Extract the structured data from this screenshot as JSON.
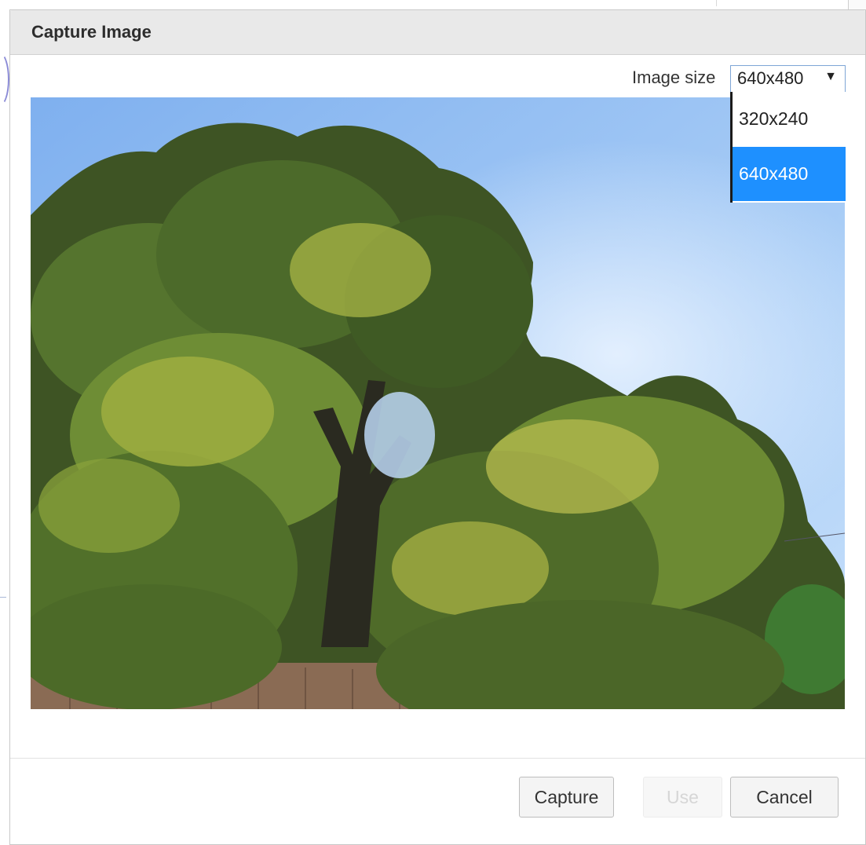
{
  "dialog": {
    "title": "Capture Image"
  },
  "image_size": {
    "label": "Image size",
    "selected": "640x480",
    "arrow_icon": "triangle-down-icon",
    "options": [
      {
        "label": "320x240",
        "highlighted": false
      },
      {
        "label": "640x480",
        "highlighted": true
      }
    ]
  },
  "preview": {
    "icon": "camera-preview-image"
  },
  "buttons": {
    "capture": "Capture",
    "use": "Use",
    "cancel": "Cancel"
  },
  "colors": {
    "header_bg": "#e9e9e9",
    "highlight": "#1e90ff",
    "button_bg": "#f4f4f4"
  }
}
